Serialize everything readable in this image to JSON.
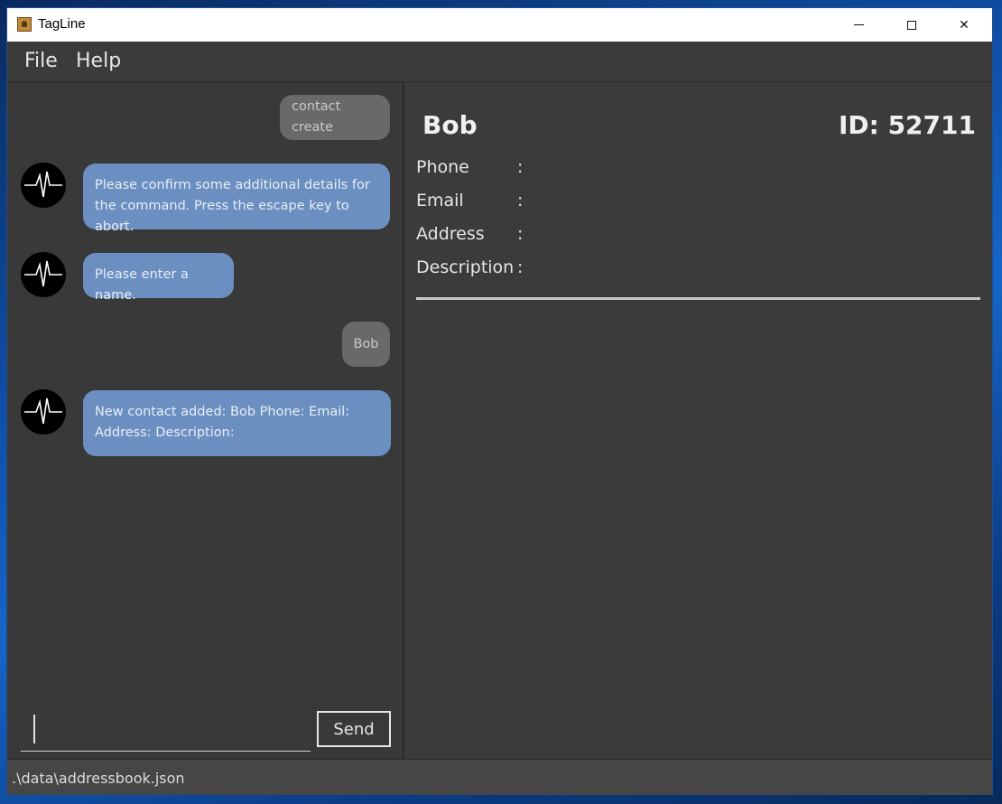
{
  "window": {
    "title": "TagLine",
    "controls": {
      "minimize_icon": "minimize-icon",
      "maximize_icon": "maximize-icon",
      "close_icon": "close-icon",
      "close_glyph": "✕"
    }
  },
  "menu": {
    "file": "File",
    "help": "Help"
  },
  "chat": {
    "messages": [
      {
        "sender": "user",
        "text": "contact create"
      },
      {
        "sender": "bot",
        "text": "Please confirm some additional details for the command. Press the escape key to abort."
      },
      {
        "sender": "bot",
        "text": "Please enter a name."
      },
      {
        "sender": "user",
        "text": "Bob"
      },
      {
        "sender": "bot",
        "text": "New contact added: Bob Phone:  Email:  Address:  Description: "
      }
    ],
    "input_value": "",
    "send_label": "Send"
  },
  "contact": {
    "name": "Bob",
    "id_label": "ID: 52711",
    "fields": [
      {
        "label": "Phone",
        "value": ""
      },
      {
        "label": "Email",
        "value": ""
      },
      {
        "label": "Address",
        "value": ""
      },
      {
        "label": "Description",
        "value": ""
      }
    ],
    "colon": ":"
  },
  "status": {
    "file_path": ".\\data\\addressbook.json"
  },
  "colors": {
    "bot_bubble": "#6a8fc0",
    "user_bubble": "#696969",
    "background": "#3b3b3b"
  }
}
